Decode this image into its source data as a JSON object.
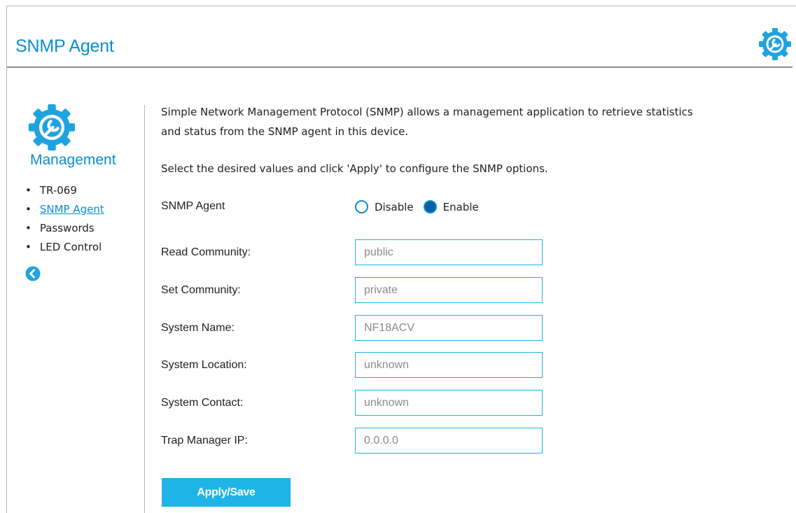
{
  "header": {
    "title": "SNMP Agent",
    "icon": "gear-wrench-icon",
    "accent_color": "#0a8ed1"
  },
  "sidebar": {
    "icon": "gear-wrench-icon",
    "title": "Management",
    "items": [
      {
        "label": "TR-069",
        "active": false
      },
      {
        "label": "SNMP Agent",
        "active": true
      },
      {
        "label": "Passwords",
        "active": false
      },
      {
        "label": "LED Control",
        "active": false
      }
    ],
    "back_icon": "arrow-left-circle-icon"
  },
  "content": {
    "description_line1": "Simple Network Management Protocol (SNMP) allows a management application to retrieve statistics",
    "description_line2": "and status from the SNMP agent in this device.",
    "instruction": "Select the desired values and click 'Apply' to configure the SNMP options.",
    "snmp_agent": {
      "label": "SNMP Agent",
      "options": [
        "Disable",
        "Enable"
      ],
      "selected": "Enable"
    },
    "fields": [
      {
        "label": "Read Community:",
        "value": "public"
      },
      {
        "label": "Set Community:",
        "value": "private"
      },
      {
        "label": "System Name:",
        "value": "NF18ACV"
      },
      {
        "label": "System Location:",
        "value": "unknown"
      },
      {
        "label": "System Contact:",
        "value": "unknown"
      },
      {
        "label": "Trap Manager IP:",
        "value": "0.0.0.0"
      }
    ],
    "apply_label": "Apply/Save",
    "button_color": "#1fb4e6"
  }
}
